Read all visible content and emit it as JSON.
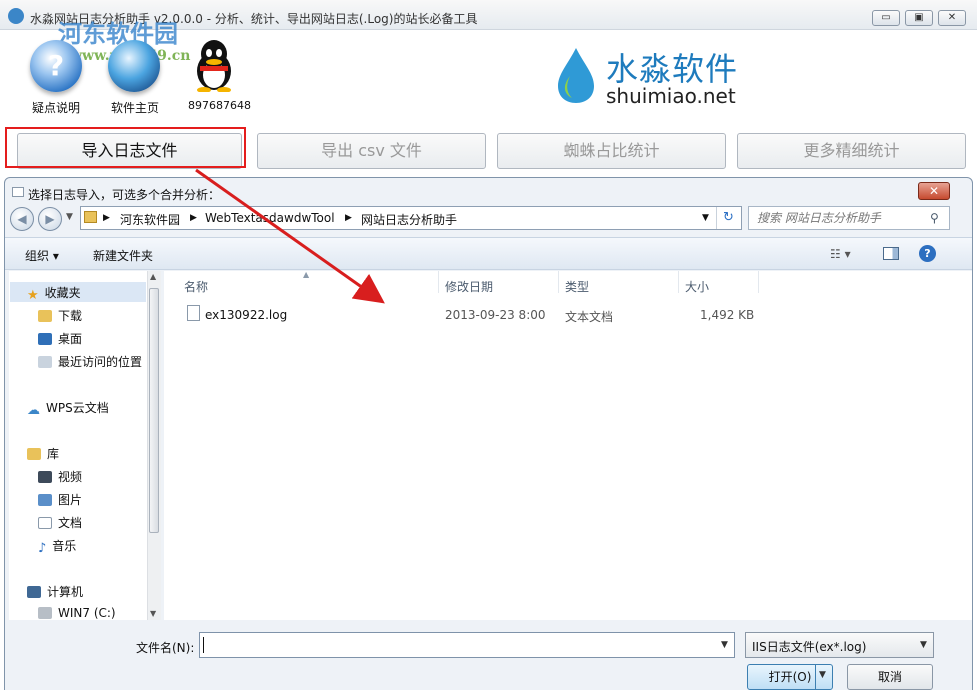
{
  "window": {
    "title": "水淼网站日志分析助手 v2.0.0.0 - 分析、统计、导出网站日志(.Log)的站长必备工具",
    "min": "▭",
    "max": "▣",
    "close": "✕"
  },
  "watermark": {
    "text": "河东软件园",
    "url": "www.pc0359.cn"
  },
  "toplinks": [
    {
      "label": "疑点说明",
      "icon": "help-icon"
    },
    {
      "label": "软件主页",
      "icon": "globe-icon"
    },
    {
      "label": "897687648",
      "icon": "qq-icon"
    }
  ],
  "brand": {
    "cn": "水淼软件",
    "en": "shuimiao.net"
  },
  "toolbar": {
    "import": "导入日志文件",
    "export": "导出 csv 文件",
    "spider": "蜘蛛占比统计",
    "more": "更多精细统计"
  },
  "dialog": {
    "title": "选择日志导入，可选多个合并分析：",
    "breadcrumb": [
      "河东软件园",
      "WebTextasdawdwTool",
      "网站日志分析助手"
    ],
    "search_placeholder": "搜索 网站日志分析助手",
    "organize": "组织 ▾",
    "new_folder": "新建文件夹",
    "nav": {
      "favorites": "收藏夹",
      "downloads": "下载",
      "desktop": "桌面",
      "recent": "最近访问的位置",
      "wps": "WPS云文档",
      "libraries": "库",
      "videos": "视频",
      "pictures": "图片",
      "documents": "文档",
      "music": "音乐",
      "computer": "计算机",
      "drive_c": "WIN7 (C:)"
    },
    "columns": {
      "name": "名称",
      "date": "修改日期",
      "type": "类型",
      "size": "大小"
    },
    "files": [
      {
        "name": "ex130922.log",
        "date": "2013-09-23 8:00",
        "type": "文本文档",
        "size": "1,492 KB"
      }
    ],
    "filename_label": "文件名(N):",
    "filename_value": "",
    "filetype": "IIS日志文件(ex*.log)",
    "open": "打开(O)",
    "cancel": "取消"
  },
  "colors": {
    "highlight_box": "#e41d1d",
    "arrow": "#d81e1e",
    "brand": "#1e7bbd"
  }
}
